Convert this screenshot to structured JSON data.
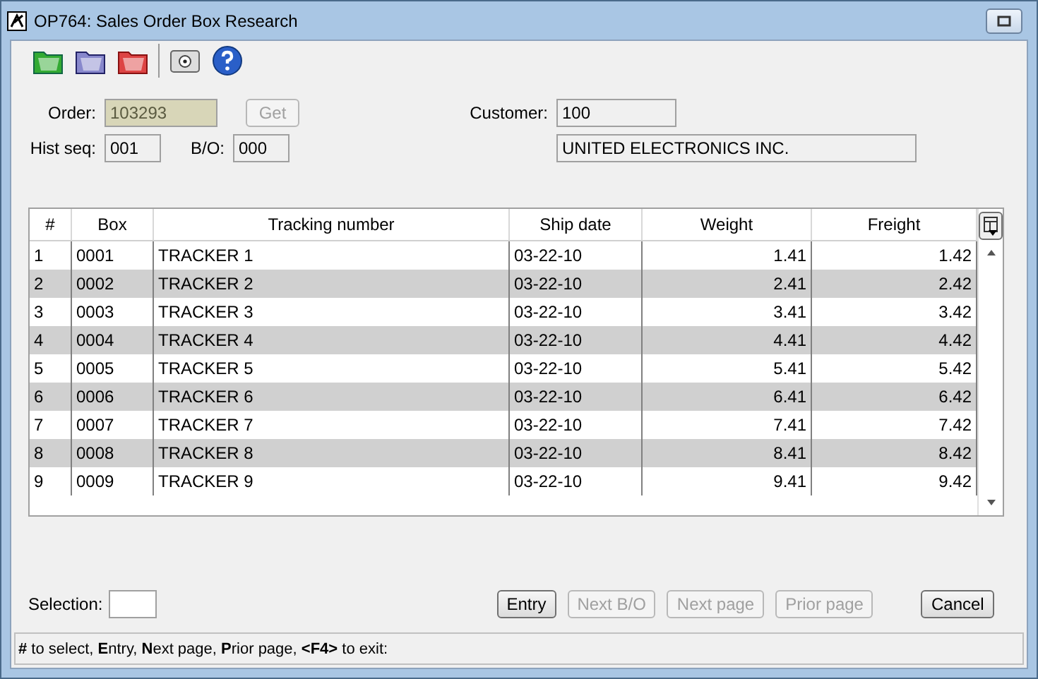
{
  "window": {
    "title": "OP764: Sales Order Box Research"
  },
  "form": {
    "order_label": "Order:",
    "order": "103293",
    "get_button": {
      "label": "Get",
      "disabled": true
    },
    "hist_seq_label": "Hist seq:",
    "hist_seq": "001",
    "bo_label": "B/O:",
    "bo": "000",
    "customer_label": "Customer:",
    "customer": "100",
    "customer_name": "UNITED ELECTRONICS INC."
  },
  "table": {
    "columns": [
      {
        "label": "#"
      },
      {
        "label": "Box"
      },
      {
        "label": "Tracking number"
      },
      {
        "label": "Ship date"
      },
      {
        "label": "Weight"
      },
      {
        "label": "Freight"
      }
    ],
    "rows": [
      [
        "1",
        "0001",
        "TRACKER 1",
        "03-22-10",
        "1.41",
        "1.42"
      ],
      [
        "2",
        "0002",
        "TRACKER 2",
        "03-22-10",
        "2.41",
        "2.42"
      ],
      [
        "3",
        "0003",
        "TRACKER 3",
        "03-22-10",
        "3.41",
        "3.42"
      ],
      [
        "4",
        "0004",
        "TRACKER 4",
        "03-22-10",
        "4.41",
        "4.42"
      ],
      [
        "5",
        "0005",
        "TRACKER 5",
        "03-22-10",
        "5.41",
        "5.42"
      ],
      [
        "6",
        "0006",
        "TRACKER 6",
        "03-22-10",
        "6.41",
        "6.42"
      ],
      [
        "7",
        "0007",
        "TRACKER 7",
        "03-22-10",
        "7.41",
        "7.42"
      ],
      [
        "8",
        "0008",
        "TRACKER 8",
        "03-22-10",
        "8.41",
        "8.42"
      ],
      [
        "9",
        "0009",
        "TRACKER 9",
        "03-22-10",
        "9.41",
        "9.42"
      ]
    ]
  },
  "selection_label": "Selection:",
  "buttons": [
    {
      "label": "Entry",
      "disabled": false
    },
    {
      "label": "Next B/O",
      "disabled": true
    },
    {
      "label": "Next page",
      "disabled": true
    },
    {
      "label": "Prior page",
      "disabled": true
    },
    {
      "label": "Cancel",
      "disabled": false
    }
  ],
  "status_bar": "**#** to select, **E**ntry, **N**ext page, **P**rior page, **<F4>** to exit:"
}
